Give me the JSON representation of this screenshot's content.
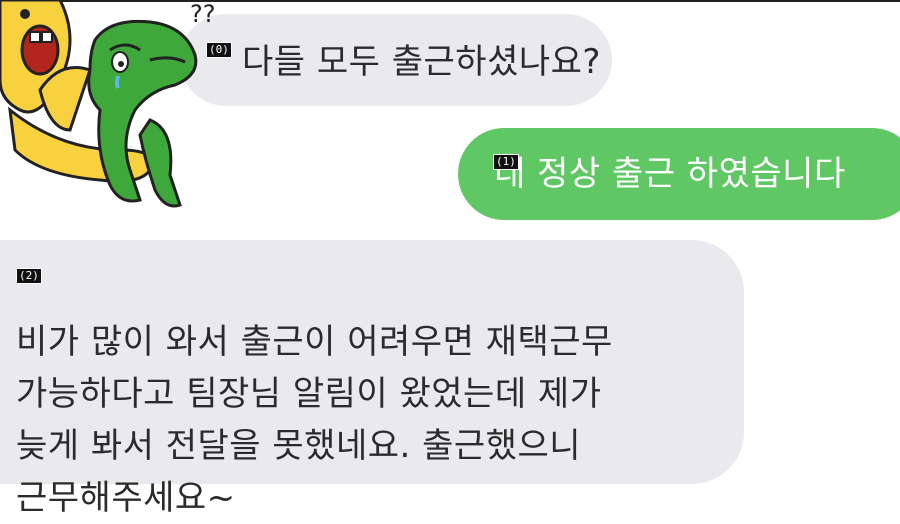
{
  "messages": [
    {
      "marker": "(0)",
      "sender": "other",
      "text": "다들 모두 출근하셨나요?"
    },
    {
      "marker": "(1)",
      "sender": "me",
      "text": "네 정상 출근 하였습니다"
    },
    {
      "marker": "(2)",
      "sender": "other",
      "text": "비가 많이 와서 출근이 어려우면 재택근무\n가능하다고 팀장님 알림이 왔었는데 제가\n늦게 봐서 전달을 못했네요. 출근했으니\n근무해주세요~"
    }
  ],
  "colors": {
    "incoming_bubble": "#e9e9ee",
    "outgoing_bubble": "#5fc864",
    "sticker_yellow": "#f7d23e",
    "sticker_green": "#3fa83a"
  },
  "icons": {
    "avatar": "sticker-yellow-bear-hugging-green-character-icon"
  }
}
